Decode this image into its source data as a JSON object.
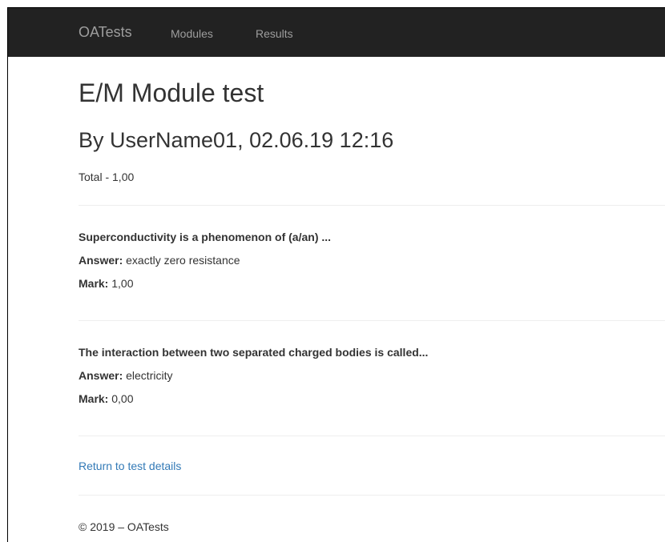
{
  "navbar": {
    "brand": "OATests",
    "links": [
      {
        "label": "Modules"
      },
      {
        "label": "Results"
      }
    ]
  },
  "page": {
    "title": "E/M Module test",
    "subtitle": "By UserName01, 02.06.19 12:16",
    "total": "Total - 1,00"
  },
  "questions": [
    {
      "text": "Superconductivity is a phenomenon of (a/an) ...",
      "answer_label": "Answer:",
      "answer": "exactly zero resistance",
      "mark_label": "Mark:",
      "mark": "1,00"
    },
    {
      "text": "The interaction between two separated charged bodies is called...",
      "answer_label": "Answer:",
      "answer": "electricity",
      "mark_label": "Mark:",
      "mark": "0,00"
    }
  ],
  "return_link": "Return to test details",
  "footer": "© 2019 – OATests",
  "colors": {
    "navbar_bg": "#222222",
    "nav_text": "#9d9d9d",
    "link": "#337ab7",
    "text": "#333333"
  }
}
